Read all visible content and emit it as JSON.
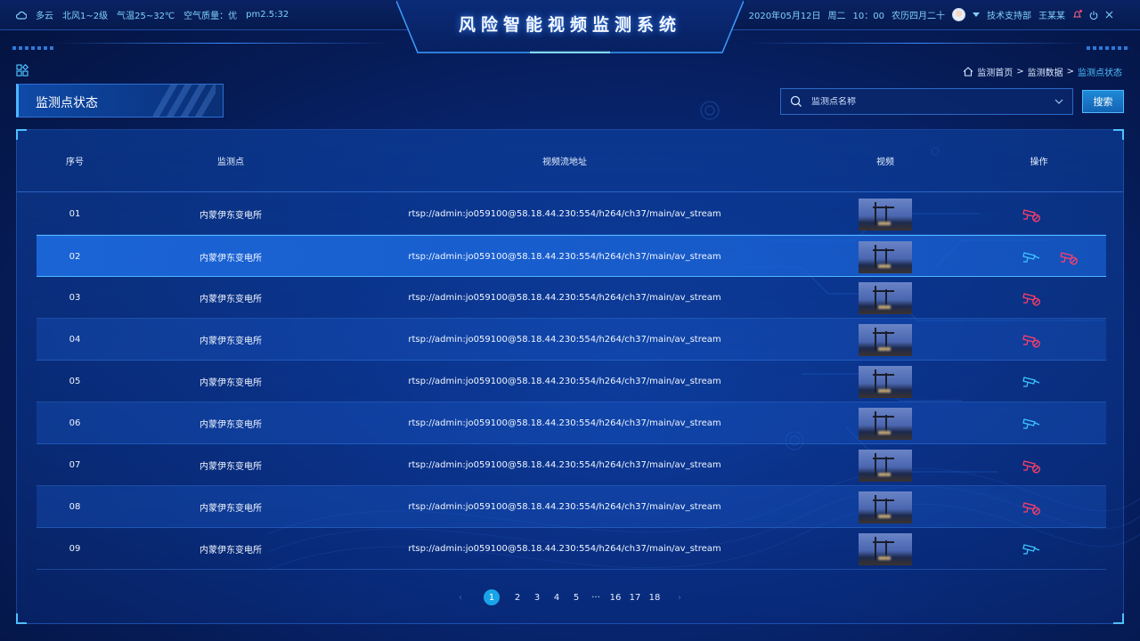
{
  "header": {
    "title": "风险智能视频监测系统",
    "weather": {
      "condition": "多云",
      "wind": "北风1~2级",
      "temperature": "气温25~32℃",
      "air_quality": "空气质量：优",
      "pm25": "pm2.5:32"
    },
    "date": "2020年05月12日",
    "weekday": "周二",
    "time": "10：00",
    "lunar": "农历四月二十",
    "support": "技术支持部",
    "user": "王某某"
  },
  "breadcrumb": [
    "监测首页",
    "监测数据",
    "监测点状态"
  ],
  "section": {
    "title": "监测点状态"
  },
  "search": {
    "placeholder": "监测点名称",
    "button": "搜索"
  },
  "table": {
    "columns": [
      "序号",
      "监测点",
      "视频流地址",
      "视频",
      "操作"
    ],
    "rows": [
      {
        "index": "01",
        "point": "内蒙伊东变电所",
        "url": "rtsp://admin:jo059100@58.18.44.230:554/h264/ch37/main/av_stream",
        "ops": [
          "camera-off"
        ]
      },
      {
        "index": "02",
        "point": "内蒙伊东变电所",
        "url": "rtsp://admin:jo059100@58.18.44.230:554/h264/ch37/main/av_stream",
        "ops": [
          "camera-on",
          "camera-off"
        ]
      },
      {
        "index": "03",
        "point": "内蒙伊东变电所",
        "url": "rtsp://admin:jo059100@58.18.44.230:554/h264/ch37/main/av_stream",
        "ops": [
          "camera-off"
        ]
      },
      {
        "index": "04",
        "point": "内蒙伊东变电所",
        "url": "rtsp://admin:jo059100@58.18.44.230:554/h264/ch37/main/av_stream",
        "ops": [
          "camera-off"
        ]
      },
      {
        "index": "05",
        "point": "内蒙伊东变电所",
        "url": "rtsp://admin:jo059100@58.18.44.230:554/h264/ch37/main/av_stream",
        "ops": [
          "camera-on"
        ]
      },
      {
        "index": "06",
        "point": "内蒙伊东变电所",
        "url": "rtsp://admin:jo059100@58.18.44.230:554/h264/ch37/main/av_stream",
        "ops": [
          "camera-on"
        ]
      },
      {
        "index": "07",
        "point": "内蒙伊东变电所",
        "url": "rtsp://admin:jo059100@58.18.44.230:554/h264/ch37/main/av_stream",
        "ops": [
          "camera-off"
        ]
      },
      {
        "index": "08",
        "point": "内蒙伊东变电所",
        "url": "rtsp://admin:jo059100@58.18.44.230:554/h264/ch37/main/av_stream",
        "ops": [
          "camera-off"
        ]
      },
      {
        "index": "09",
        "point": "内蒙伊东变电所",
        "url": "rtsp://admin:jo059100@58.18.44.230:554/h264/ch37/main/av_stream",
        "ops": [
          "camera-on"
        ]
      }
    ],
    "selected_row": 1
  },
  "pagination": {
    "pages": [
      "1",
      "2",
      "3",
      "4",
      "5",
      "···",
      "16",
      "17",
      "18"
    ],
    "current": "1",
    "prev": "‹",
    "next": "›"
  },
  "colors": {
    "accent": "#1aa4e8",
    "camera_on": "#3ec3ff",
    "camera_off": "#ff3d6b",
    "breadcrumb_current": "#4fc0ff"
  }
}
